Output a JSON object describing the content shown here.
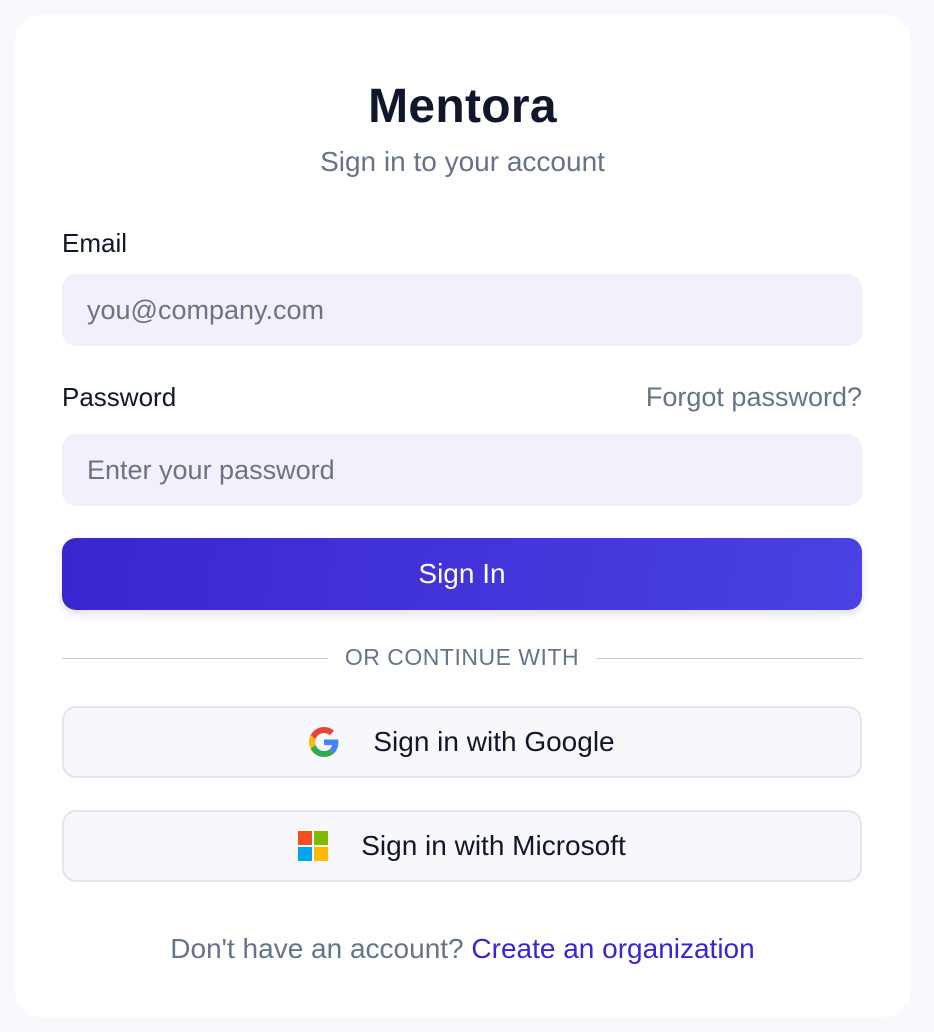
{
  "app": {
    "name": "Mentora",
    "subtitle": "Sign in to your account"
  },
  "form": {
    "email_label": "Email",
    "email_placeholder": "you@company.com",
    "email_value": "",
    "password_label": "Password",
    "password_placeholder": "Enter your password",
    "password_value": "",
    "forgot_link": "Forgot password?",
    "submit_label": "Sign In"
  },
  "divider": {
    "text": "OR CONTINUE WITH"
  },
  "social": {
    "google_label": "Sign in with Google",
    "google_icon": "google-icon",
    "microsoft_label": "Sign in with Microsoft",
    "microsoft_icon": "microsoft-icon"
  },
  "footer": {
    "prompt": "Don't have an account?",
    "link": "Create an organization"
  },
  "colors": {
    "brand_primary": "#3a26cf",
    "text_dark": "#0f172a",
    "text_muted": "#64748b",
    "input_bg": "#f2f1fb"
  }
}
